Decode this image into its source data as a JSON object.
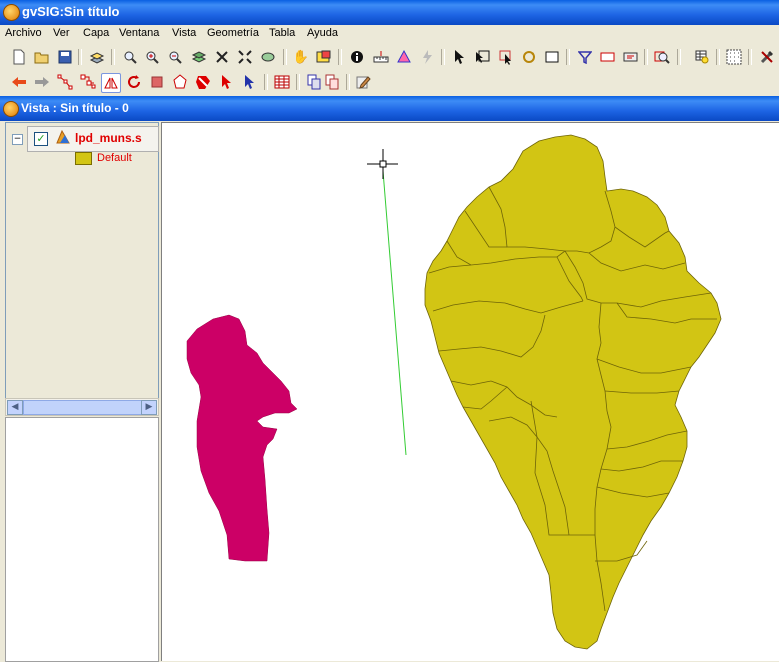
{
  "window": {
    "title": "gvSIG:Sin título"
  },
  "menu": [
    "Archivo",
    "Ver",
    "Capa",
    "Ventana",
    "Vista",
    "Geometría",
    "Tabla",
    "Ayuda"
  ],
  "view": {
    "title": "Vista : Sin título - 0",
    "toc": {
      "expander": "−",
      "layer_name": "lpd_muns.s",
      "checked": true,
      "legend_label": "Default",
      "legend_color": "#d2c514"
    }
  },
  "map": {
    "colors": {
      "selected": "#cc0066",
      "layer_fill": "#d2c514",
      "layer_stroke": "#6e6408",
      "measure_line": "#33cc33"
    }
  },
  "icons": {
    "toolbar1": [
      "new-document-icon",
      "open-icon",
      "save-icon",
      "layers-icon",
      "zoom-full-icon",
      "zoom-in-icon",
      "zoom-out-icon",
      "zoom-layer-icon",
      "zoom-extent-icon",
      "zoom-selection-icon",
      "zoom-previous-icon",
      "pan-icon",
      "locator-icon",
      "info-icon",
      "measure-distance-icon",
      "measure-area-icon",
      "hyperlink-icon",
      "select-icon",
      "select-rectangle-icon",
      "select-polygon-icon",
      "switch-selection-icon",
      "clear-selection-icon",
      "filter-icon",
      "select-by-rectangle-icon",
      "select-by-layer-icon",
      "zoom-to-selection-icon",
      "table-icon",
      "grid-icon",
      "tools-icon"
    ],
    "toolbar2": [
      "undo-icon",
      "redo-icon",
      "line-tool-icon",
      "node-tool-icon",
      "symmetry-icon",
      "rotate-icon",
      "scale-icon",
      "polygon-icon",
      "delete-icon",
      "select-cursor-icon",
      "pointer-icon",
      "table-grid-icon",
      "copy-layer-icon",
      "paste-layer-icon",
      "edit-icon"
    ]
  }
}
